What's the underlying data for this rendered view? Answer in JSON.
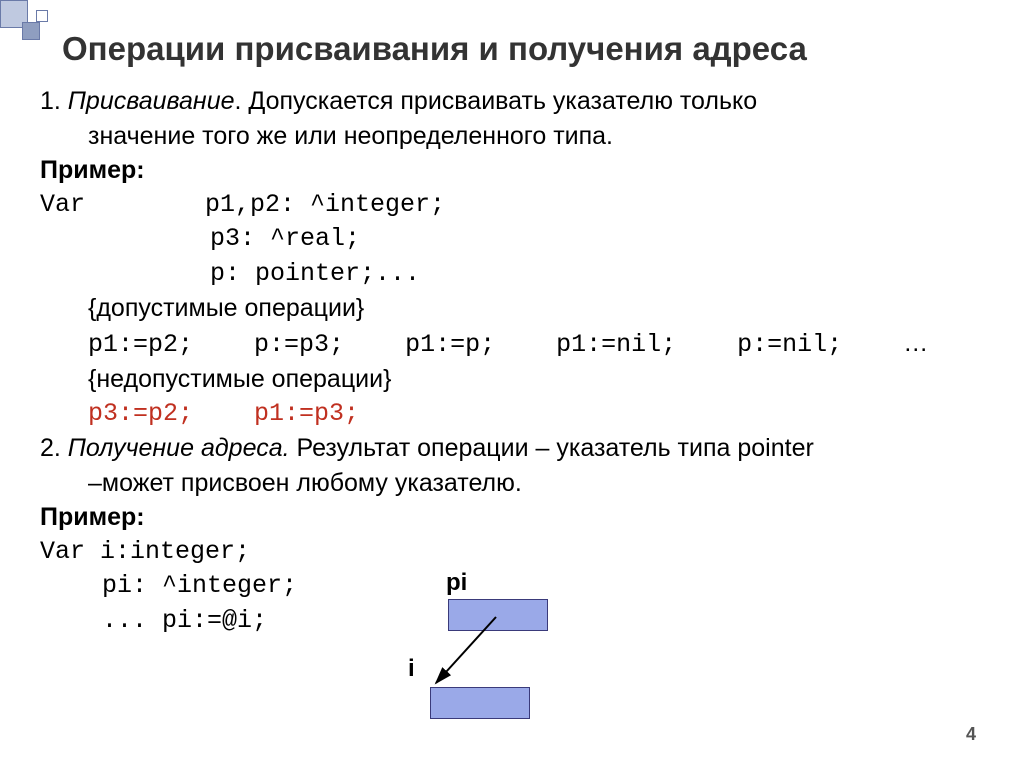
{
  "title": "Операции присваивания и получения адреса",
  "line1_num": "1. ",
  "line1_emph": "Присваивание",
  "line1_rest": ". Допускается присваивать указателю только",
  "line1_cont": "значение того же или неопределенного типа.",
  "example_label": "Пример:",
  "var_kw": "Var",
  "decl1": "p1,p2: ^integer;",
  "decl2": "p3: ^real;",
  "decl3": "p: pointer;...",
  "comment_valid": "{допустимые операции}",
  "op_a": "p1:=p2;",
  "op_b": "p:=p3;",
  "op_c": "p1:=p;",
  "op_d": "p1:=nil;",
  "op_e": "p:=nil;",
  "op_ell": "…",
  "comment_invalid": "{недопустимые операции}",
  "op_bad_a": "p3:=p2;",
  "op_bad_b": "p1:=p3;",
  "line2_num": "2. ",
  "line2_emph": "Получение адреса.",
  "line2_rest": " Результат операции – указатель типа pointer",
  "line2_cont": "–может присвоен любому указателю.",
  "decl_b1_pre": "Var ",
  "decl_b1": "i:integer;",
  "decl_b2": "pi: ^integer;",
  "decl_b3": "...  pi:=@i;",
  "diagram_label_pi": "pi",
  "diagram_label_i": "i",
  "page_number": "4"
}
